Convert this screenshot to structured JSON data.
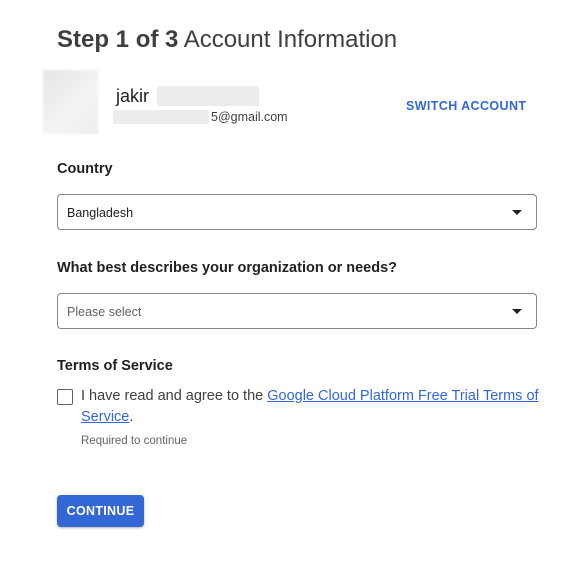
{
  "header": {
    "step": "Step 1 of 3",
    "title": "Account Information"
  },
  "account": {
    "name": "jakir",
    "email_suffix": "5@gmail.com",
    "switch_label": "SWITCH ACCOUNT"
  },
  "country": {
    "label": "Country",
    "selected": "Bangladesh"
  },
  "organization": {
    "label": "What best describes your organization or needs?",
    "placeholder": "Please select"
  },
  "terms": {
    "heading": "Terms of Service",
    "text_prefix": "I have read and agree to the ",
    "link_text": "Google Cloud Platform Free Trial Terms of Service",
    "text_suffix": ".",
    "checked": false,
    "helper": "Required to continue"
  },
  "actions": {
    "continue_label": "CONTINUE"
  },
  "colors": {
    "accent": "#3367d6",
    "text": "#202124"
  }
}
